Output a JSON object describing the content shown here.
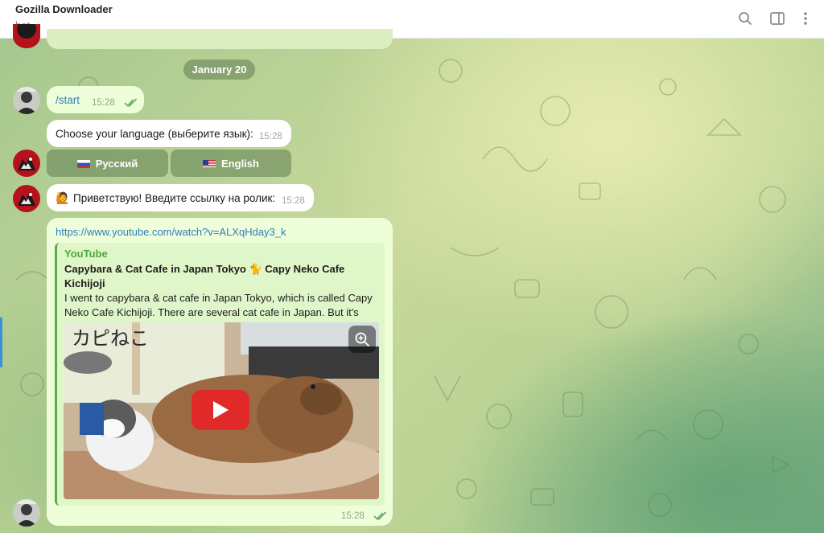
{
  "header": {
    "title": "Gozilla Downloader",
    "subtitle": "bot",
    "icons": [
      "search-icon",
      "sidebar-toggle-icon",
      "more-vertical-icon"
    ]
  },
  "date_separator": "January 20",
  "messages": [
    {
      "direction": "out",
      "text": "/start",
      "time": "15:28",
      "status": "read"
    },
    {
      "direction": "in",
      "text": "Choose your language (выберите язык):",
      "time": "15:28"
    },
    {
      "direction": "in",
      "emoji": "🙋",
      "text": "Приветствую! Введите ссылку на ролик:",
      "time": "15:28"
    },
    {
      "direction": "out",
      "link": "https://www.youtube.com/watch?v=ALXqHday3_k",
      "time": "15:28",
      "status": "read",
      "preview": {
        "site": "YouTube",
        "title": "Capybara & Cat Cafe in Japan Tokyo 🐈 Capy Neko Cafe Kichijoji",
        "description": "I went to capybara & cat cafe in Japan Tokyo, which is called Capy Neko Cafe Kichijoji. There are several cat cafe in Japan. But it's qu...",
        "image_sign_text": "カピねこ"
      }
    }
  ],
  "keyboard": [
    {
      "flag": "ru",
      "label": "Русский"
    },
    {
      "flag": "us",
      "label": "English"
    }
  ],
  "colors": {
    "incoming_bubble": "#ffffff",
    "outgoing_bubble": "#eefed8",
    "link": "#2f7dc0",
    "preview_accent": "#4ea73c",
    "play_button": "#e02a2a"
  }
}
